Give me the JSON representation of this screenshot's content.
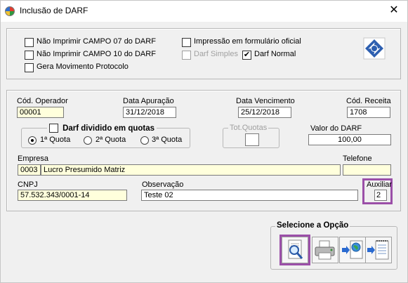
{
  "window": {
    "title": "Inclusão de DARF",
    "close_glyph": "✕"
  },
  "options": {
    "nao_imprimir_07": {
      "label": "Não Imprimir CAMPO 07 do DARF",
      "checked": false
    },
    "nao_imprimir_10": {
      "label": "Não Imprimir CAMPO 10 do DARF",
      "checked": false
    },
    "gera_movimento": {
      "label": "Gera Movimento Protocolo",
      "checked": false
    },
    "impressao_formulario": {
      "label": "Impressão em formulário oficial",
      "checked": false
    },
    "darf_simples": {
      "label": "Darf Simples",
      "checked": false,
      "disabled": true
    },
    "darf_normal": {
      "label": "Darf Normal",
      "checked": true,
      "check_glyph": "✔"
    }
  },
  "form": {
    "cod_operador": {
      "label": "Cód. Operador",
      "value": "00001"
    },
    "data_apuracao": {
      "label": "Data  Apuração",
      "value": "31/12/2018"
    },
    "data_vencimento": {
      "label": "Data  Vencimento",
      "value": "25/12/2018"
    },
    "cod_receita": {
      "label": "Cód. Receita",
      "value": "1708"
    },
    "darf_dividido": {
      "label": "Darf dividido em quotas",
      "checked": false
    },
    "quotas": [
      {
        "label": "1ª Quota",
        "selected": true
      },
      {
        "label": "2ª Quota",
        "selected": false
      },
      {
        "label": "3ª Quota",
        "selected": false
      }
    ],
    "tot_quotas": {
      "label": "Tot.Quotas",
      "value": ""
    },
    "valor_darf": {
      "label": "Valor do DARF",
      "value": "100,00"
    },
    "empresa": {
      "label": "Empresa",
      "code": "0003",
      "name": "Lucro Presumido Matriz"
    },
    "telefone": {
      "label": "Telefone",
      "value": ""
    },
    "cnpj": {
      "label": "CNPJ",
      "value": "57.532.343/0001-14"
    },
    "observacao": {
      "label": "Observação",
      "value": "Teste 02"
    },
    "auxiliar": {
      "label": "Auxiliar",
      "value": "2"
    }
  },
  "actions": {
    "group_label": "Selecione a Opção",
    "buttons": [
      {
        "name": "preview",
        "icon": "magnifier-document-icon"
      },
      {
        "name": "print",
        "icon": "printer-icon"
      },
      {
        "name": "export-web",
        "icon": "globe-export-icon"
      },
      {
        "name": "export-file",
        "icon": "notepad-export-icon"
      }
    ]
  },
  "colors": {
    "highlight": "#9b4fa8",
    "field_yellow": "#ffffdc",
    "logo_blue": "#2d5fb0"
  }
}
